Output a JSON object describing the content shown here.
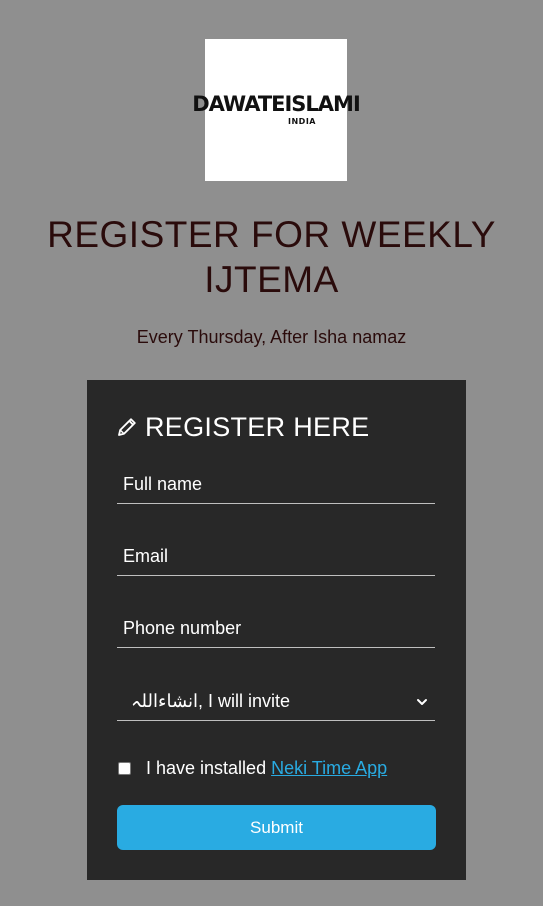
{
  "logo": {
    "main": "DAWATEISLAMI",
    "sub": "INDIA"
  },
  "title": "REGISTER FOR WEEKLY IJTEMA",
  "subtitle": "Every Thursday, After Isha namaz",
  "form": {
    "heading": "REGISTER HERE",
    "heading_icon": "pencil-icon",
    "full_name_placeholder": "Full name",
    "email_placeholder": "Email",
    "phone_placeholder": "Phone number",
    "invite_selected": "انشاءاللہ, I will invite",
    "checkbox_label": "I have installed",
    "checkbox_link": "Neki Time App",
    "submit_label": "Submit"
  },
  "colors": {
    "background": "#8f8f8f",
    "card": "#282828",
    "accent": "#29abe2",
    "title": "#2a0b0b"
  }
}
